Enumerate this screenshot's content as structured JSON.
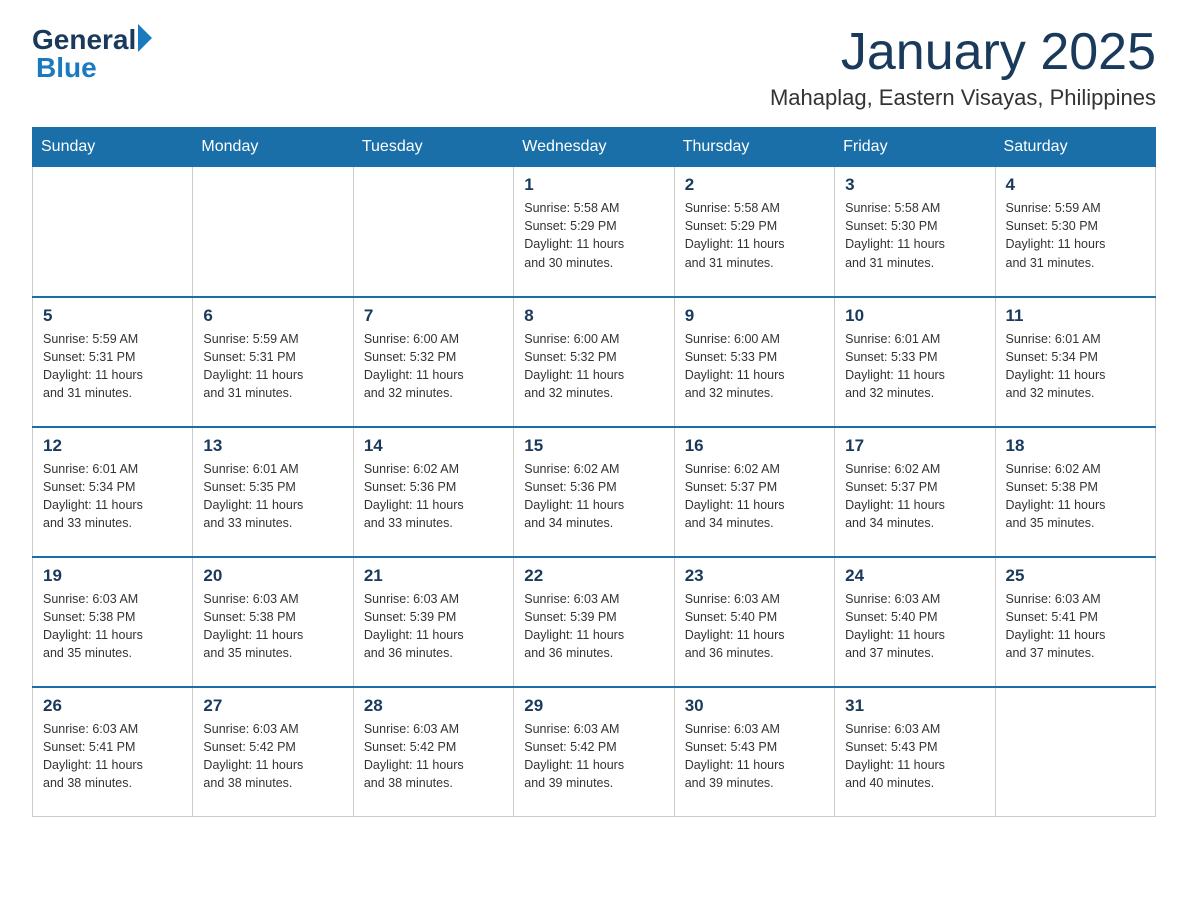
{
  "header": {
    "logo_general": "General",
    "logo_blue": "Blue",
    "month_year": "January 2025",
    "location": "Mahaplag, Eastern Visayas, Philippines"
  },
  "weekdays": [
    "Sunday",
    "Monday",
    "Tuesday",
    "Wednesday",
    "Thursday",
    "Friday",
    "Saturday"
  ],
  "weeks": [
    [
      {
        "day": "",
        "info": ""
      },
      {
        "day": "",
        "info": ""
      },
      {
        "day": "",
        "info": ""
      },
      {
        "day": "1",
        "info": "Sunrise: 5:58 AM\nSunset: 5:29 PM\nDaylight: 11 hours\nand 30 minutes."
      },
      {
        "day": "2",
        "info": "Sunrise: 5:58 AM\nSunset: 5:29 PM\nDaylight: 11 hours\nand 31 minutes."
      },
      {
        "day": "3",
        "info": "Sunrise: 5:58 AM\nSunset: 5:30 PM\nDaylight: 11 hours\nand 31 minutes."
      },
      {
        "day": "4",
        "info": "Sunrise: 5:59 AM\nSunset: 5:30 PM\nDaylight: 11 hours\nand 31 minutes."
      }
    ],
    [
      {
        "day": "5",
        "info": "Sunrise: 5:59 AM\nSunset: 5:31 PM\nDaylight: 11 hours\nand 31 minutes."
      },
      {
        "day": "6",
        "info": "Sunrise: 5:59 AM\nSunset: 5:31 PM\nDaylight: 11 hours\nand 31 minutes."
      },
      {
        "day": "7",
        "info": "Sunrise: 6:00 AM\nSunset: 5:32 PM\nDaylight: 11 hours\nand 32 minutes."
      },
      {
        "day": "8",
        "info": "Sunrise: 6:00 AM\nSunset: 5:32 PM\nDaylight: 11 hours\nand 32 minutes."
      },
      {
        "day": "9",
        "info": "Sunrise: 6:00 AM\nSunset: 5:33 PM\nDaylight: 11 hours\nand 32 minutes."
      },
      {
        "day": "10",
        "info": "Sunrise: 6:01 AM\nSunset: 5:33 PM\nDaylight: 11 hours\nand 32 minutes."
      },
      {
        "day": "11",
        "info": "Sunrise: 6:01 AM\nSunset: 5:34 PM\nDaylight: 11 hours\nand 32 minutes."
      }
    ],
    [
      {
        "day": "12",
        "info": "Sunrise: 6:01 AM\nSunset: 5:34 PM\nDaylight: 11 hours\nand 33 minutes."
      },
      {
        "day": "13",
        "info": "Sunrise: 6:01 AM\nSunset: 5:35 PM\nDaylight: 11 hours\nand 33 minutes."
      },
      {
        "day": "14",
        "info": "Sunrise: 6:02 AM\nSunset: 5:36 PM\nDaylight: 11 hours\nand 33 minutes."
      },
      {
        "day": "15",
        "info": "Sunrise: 6:02 AM\nSunset: 5:36 PM\nDaylight: 11 hours\nand 34 minutes."
      },
      {
        "day": "16",
        "info": "Sunrise: 6:02 AM\nSunset: 5:37 PM\nDaylight: 11 hours\nand 34 minutes."
      },
      {
        "day": "17",
        "info": "Sunrise: 6:02 AM\nSunset: 5:37 PM\nDaylight: 11 hours\nand 34 minutes."
      },
      {
        "day": "18",
        "info": "Sunrise: 6:02 AM\nSunset: 5:38 PM\nDaylight: 11 hours\nand 35 minutes."
      }
    ],
    [
      {
        "day": "19",
        "info": "Sunrise: 6:03 AM\nSunset: 5:38 PM\nDaylight: 11 hours\nand 35 minutes."
      },
      {
        "day": "20",
        "info": "Sunrise: 6:03 AM\nSunset: 5:38 PM\nDaylight: 11 hours\nand 35 minutes."
      },
      {
        "day": "21",
        "info": "Sunrise: 6:03 AM\nSunset: 5:39 PM\nDaylight: 11 hours\nand 36 minutes."
      },
      {
        "day": "22",
        "info": "Sunrise: 6:03 AM\nSunset: 5:39 PM\nDaylight: 11 hours\nand 36 minutes."
      },
      {
        "day": "23",
        "info": "Sunrise: 6:03 AM\nSunset: 5:40 PM\nDaylight: 11 hours\nand 36 minutes."
      },
      {
        "day": "24",
        "info": "Sunrise: 6:03 AM\nSunset: 5:40 PM\nDaylight: 11 hours\nand 37 minutes."
      },
      {
        "day": "25",
        "info": "Sunrise: 6:03 AM\nSunset: 5:41 PM\nDaylight: 11 hours\nand 37 minutes."
      }
    ],
    [
      {
        "day": "26",
        "info": "Sunrise: 6:03 AM\nSunset: 5:41 PM\nDaylight: 11 hours\nand 38 minutes."
      },
      {
        "day": "27",
        "info": "Sunrise: 6:03 AM\nSunset: 5:42 PM\nDaylight: 11 hours\nand 38 minutes."
      },
      {
        "day": "28",
        "info": "Sunrise: 6:03 AM\nSunset: 5:42 PM\nDaylight: 11 hours\nand 38 minutes."
      },
      {
        "day": "29",
        "info": "Sunrise: 6:03 AM\nSunset: 5:42 PM\nDaylight: 11 hours\nand 39 minutes."
      },
      {
        "day": "30",
        "info": "Sunrise: 6:03 AM\nSunset: 5:43 PM\nDaylight: 11 hours\nand 39 minutes."
      },
      {
        "day": "31",
        "info": "Sunrise: 6:03 AM\nSunset: 5:43 PM\nDaylight: 11 hours\nand 40 minutes."
      },
      {
        "day": "",
        "info": ""
      }
    ]
  ]
}
